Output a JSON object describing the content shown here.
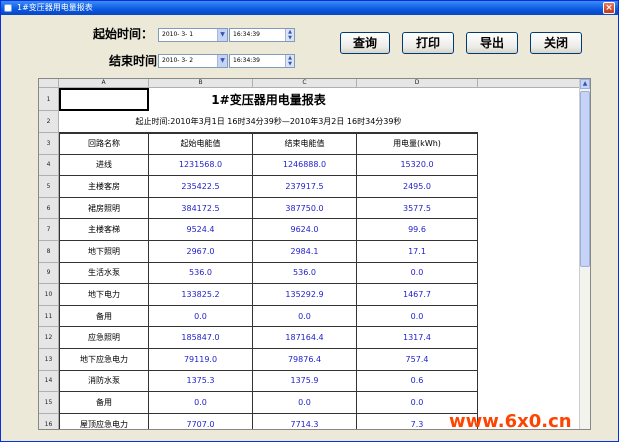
{
  "window": {
    "title": "1#变压器用电量报表",
    "close": "×"
  },
  "query": {
    "start_label": "起始时间：",
    "end_label": "结束时间：",
    "start_date": "2010- 3- 1",
    "start_time": "16:34:39",
    "end_date": "2010- 3- 2",
    "end_time": "16:34:39"
  },
  "toolbar": {
    "query": "查询",
    "print": "打印",
    "export": "导出",
    "close": "关闭"
  },
  "sheet": {
    "columns": [
      "A",
      "B",
      "C",
      "D"
    ],
    "title": "1#变压器用电量报表",
    "subtitle": "起止时间:2010年3月1日 16时34分39秒—2010年3月2日 16时34分39秒",
    "headers": [
      "回路名称",
      "起始电能值",
      "结束电能值",
      "用电量(kWh)"
    ],
    "row_numbers": [
      "1",
      "2",
      "3",
      "4",
      "5",
      "6",
      "7",
      "8",
      "9",
      "10",
      "11",
      "12",
      "13",
      "14",
      "15",
      "16"
    ],
    "rows": [
      [
        "进线",
        "1231568.0",
        "1246888.0",
        "15320.0"
      ],
      [
        "主楼客房",
        "235422.5",
        "237917.5",
        "2495.0"
      ],
      [
        "裙房照明",
        "384172.5",
        "387750.0",
        "3577.5"
      ],
      [
        "主楼客梯",
        "9524.4",
        "9624.0",
        "99.6"
      ],
      [
        "地下照明",
        "2967.0",
        "2984.1",
        "17.1"
      ],
      [
        "生活水泵",
        "536.0",
        "536.0",
        "0.0"
      ],
      [
        "地下电力",
        "133825.2",
        "135292.9",
        "1467.7"
      ],
      [
        "备用",
        "0.0",
        "0.0",
        "0.0"
      ],
      [
        "应急照明",
        "185847.0",
        "187164.4",
        "1317.4"
      ],
      [
        "地下应急电力",
        "79119.0",
        "79876.4",
        "757.4"
      ],
      [
        "消防水泵",
        "1375.3",
        "1375.9",
        "0.6"
      ],
      [
        "备用",
        "0.0",
        "0.0",
        "0.0"
      ],
      [
        "屋顶应急电力",
        "7707.0",
        "7714.3",
        "7.3"
      ]
    ]
  },
  "watermark": "www.6x0.cn"
}
